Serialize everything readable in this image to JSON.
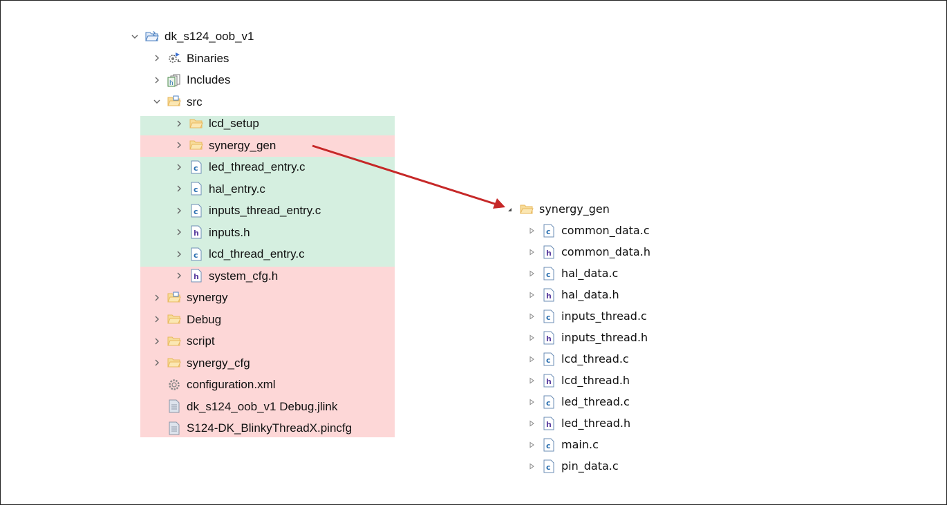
{
  "left_tree": {
    "project": {
      "label": "dk_s124_oob_v1",
      "expanded": true
    },
    "binaries": {
      "label": "Binaries"
    },
    "includes": {
      "label": "Includes"
    },
    "src": {
      "label": "src",
      "expanded": true
    },
    "src_items": [
      {
        "label": "lcd_setup",
        "type": "folder",
        "highlight": "green"
      },
      {
        "label": "synergy_gen",
        "type": "folder",
        "highlight": "red"
      },
      {
        "label": "led_thread_entry.c",
        "type": "c",
        "highlight": "green"
      },
      {
        "label": "hal_entry.c",
        "type": "c",
        "highlight": "green"
      },
      {
        "label": "inputs_thread_entry.c",
        "type": "c",
        "highlight": "green"
      },
      {
        "label": "inputs.h",
        "type": "h",
        "highlight": "green"
      },
      {
        "label": "lcd_thread_entry.c",
        "type": "c",
        "highlight": "green"
      },
      {
        "label": "system_cfg.h",
        "type": "h",
        "highlight": "red"
      }
    ],
    "project_items": [
      {
        "label": "synergy",
        "type": "srcfolder",
        "highlight": "red"
      },
      {
        "label": "Debug",
        "type": "folder",
        "highlight": "red"
      },
      {
        "label": "script",
        "type": "folder",
        "highlight": "red"
      },
      {
        "label": "synergy_cfg",
        "type": "folder",
        "highlight": "red"
      },
      {
        "label": "configuration.xml",
        "type": "gear",
        "highlight": "red"
      },
      {
        "label": "dk_s124_oob_v1 Debug.jlink",
        "type": "doc",
        "highlight": "red"
      },
      {
        "label": "S124-DK_BlinkyThreadX.pincfg",
        "type": "doc",
        "highlight": "red"
      }
    ]
  },
  "right_tree": {
    "folder": {
      "label": "synergy_gen",
      "expanded": true
    },
    "files": [
      {
        "label": "common_data.c",
        "type": "c"
      },
      {
        "label": "common_data.h",
        "type": "h"
      },
      {
        "label": "hal_data.c",
        "type": "c"
      },
      {
        "label": "hal_data.h",
        "type": "h"
      },
      {
        "label": "inputs_thread.c",
        "type": "c"
      },
      {
        "label": "inputs_thread.h",
        "type": "h"
      },
      {
        "label": "lcd_thread.c",
        "type": "c"
      },
      {
        "label": "lcd_thread.h",
        "type": "h"
      },
      {
        "label": "led_thread.c",
        "type": "c"
      },
      {
        "label": "led_thread.h",
        "type": "h"
      },
      {
        "label": "main.c",
        "type": "c"
      },
      {
        "label": "pin_data.c",
        "type": "c"
      }
    ]
  },
  "colors": {
    "green_highlight": "#d5efe0",
    "red_highlight": "#fdd7d7",
    "arrow": "#c62828",
    "folder": "#e8b85e",
    "project_folder": "#4a7fc0"
  },
  "icons": {
    "expanded": "chevron-down-icon",
    "collapsed": "chevron-right-icon",
    "right_expanded": "triangle-down-icon",
    "right_collapsed": "triangle-right-icon",
    "c_file": "c-file-icon",
    "h_file": "h-file-icon",
    "folder": "folder-icon",
    "source_folder": "source-folder-icon",
    "project": "project-icon",
    "binaries": "binaries-icon",
    "includes": "includes-icon",
    "gear": "gear-icon",
    "document": "document-icon"
  }
}
